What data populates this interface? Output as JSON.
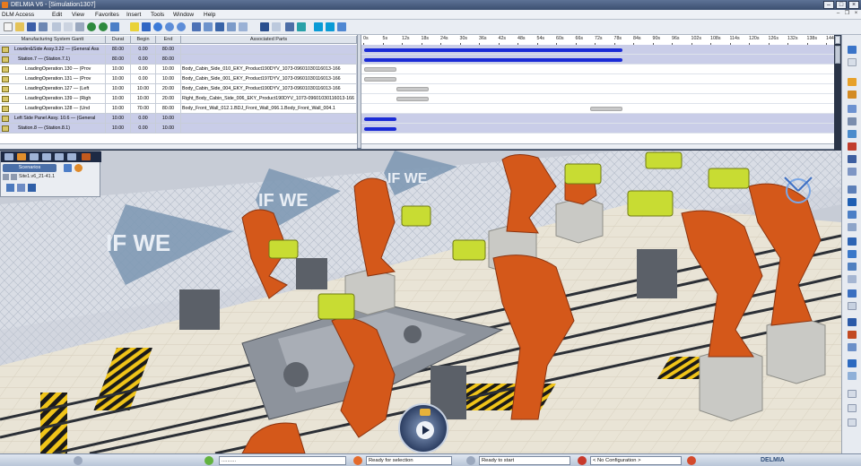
{
  "window": {
    "title": "DELMIA V6 - [Simulation1307]"
  },
  "menu": {
    "items": [
      "DLM Access",
      "Edit",
      "View",
      "Favorites",
      "Insert",
      "Tools",
      "Window",
      "Help"
    ]
  },
  "gantt": {
    "columns": [
      "Manufacturing System Gantt",
      "Durat",
      "Begin",
      "End",
      "Associated Parts"
    ],
    "rows": [
      {
        "name": "Lowder&Side Assy.3.22 — (General Ass",
        "durat": "80.00",
        "begin": "0.00",
        "end": "80.00",
        "parts": "",
        "indent": 1,
        "selected": true
      },
      {
        "name": "Station.7 — (Station.7.1)",
        "durat": "80.00",
        "begin": "0.00",
        "end": "80.00",
        "parts": "",
        "indent": 2,
        "selected": true
      },
      {
        "name": "LoadingOperation.130 — (Prov",
        "durat": "10.00",
        "begin": "0.00",
        "end": "10.00",
        "parts": "Body_Cabin_Side_010_EKY_Product190DYV_1073-09601030116013-166",
        "indent": 4,
        "selected": false
      },
      {
        "name": "LoadingOperation.131 — (Prov",
        "durat": "10.00",
        "begin": "0.00",
        "end": "10.00",
        "parts": "Body_Cabin_Side_001_EKY_Product197DYV_1073-09601030116013-166",
        "indent": 4,
        "selected": false
      },
      {
        "name": "LoadingOperation.127 — (Left",
        "durat": "10.00",
        "begin": "10.00",
        "end": "20.00",
        "parts": "Body_Cabin_Side_004_EKY_Product190DYV_1073-09601030116013-166",
        "indent": 4,
        "selected": false
      },
      {
        "name": "LoadingOperation.139 — (Righ",
        "durat": "10.00",
        "begin": "10.00",
        "end": "20.00",
        "parts": "Right_Body_Cabin_Side_006_EKY_Product190DYV_1073-09601030116013-166",
        "indent": 4,
        "selected": false
      },
      {
        "name": "LoadingOperation.128 — (Und",
        "durat": "10.00",
        "begin": "70.00",
        "end": "80.00",
        "parts": "Body_Front_Wall_012.1.BDJ_Front_Wall_066.1.Body_Front_Wall_004.1",
        "indent": 4,
        "selected": false
      },
      {
        "name": "Left Side Panel Assy. 10.6 — (General",
        "durat": "10.00",
        "begin": "0.00",
        "end": "10.00",
        "parts": "",
        "indent": 1,
        "selected": true
      },
      {
        "name": "Station.8 — (Station.8.1)",
        "durat": "10.00",
        "begin": "0.00",
        "end": "10.00",
        "parts": "",
        "indent": 2,
        "selected": true
      }
    ],
    "timeline": {
      "unit_labels": [
        "0s",
        "5s",
        "12s",
        "18s",
        "24s",
        "30s",
        "36s",
        "42s",
        "48s",
        "54s",
        "60s",
        "66s",
        "72s",
        "78s",
        "84s",
        "90s",
        "96s",
        "102s",
        "108s",
        "114s",
        "120s",
        "126s",
        "132s",
        "138s",
        "144s"
      ],
      "bars": [
        {
          "row": 0,
          "start": 0,
          "end": 80,
          "kind": "blue"
        },
        {
          "row": 1,
          "start": 0,
          "end": 80,
          "kind": "blue"
        },
        {
          "row": 2,
          "start": 0,
          "end": 10,
          "kind": "gray"
        },
        {
          "row": 3,
          "start": 0,
          "end": 10,
          "kind": "gray"
        },
        {
          "row": 4,
          "start": 10,
          "end": 20,
          "kind": "gray"
        },
        {
          "row": 5,
          "start": 10,
          "end": 20,
          "kind": "gray"
        },
        {
          "row": 6,
          "start": 70,
          "end": 80,
          "kind": "gray"
        },
        {
          "row": 7,
          "start": 0,
          "end": 10,
          "kind": "blue"
        },
        {
          "row": 8,
          "start": 0,
          "end": 10,
          "kind": "blue"
        }
      ]
    }
  },
  "tree_panel": {
    "tab_label": "Scenarios",
    "site_label": "Site1.v6_21-41.1"
  },
  "viewport": {
    "banner_text": "IF WE",
    "compass_icon": "play-icon"
  },
  "statusbar": {
    "field1": "..........",
    "field2": "Ready for selection",
    "field3": "Ready to start",
    "field4": "< No Configuration >",
    "brand": "DELMIA"
  },
  "colors": {
    "robot": "#d4581a",
    "gripper": "#c8dc33",
    "floor": "#e7e2d3",
    "bar_blue": "#1a2bd6",
    "selected_row": "#c9cde8"
  }
}
